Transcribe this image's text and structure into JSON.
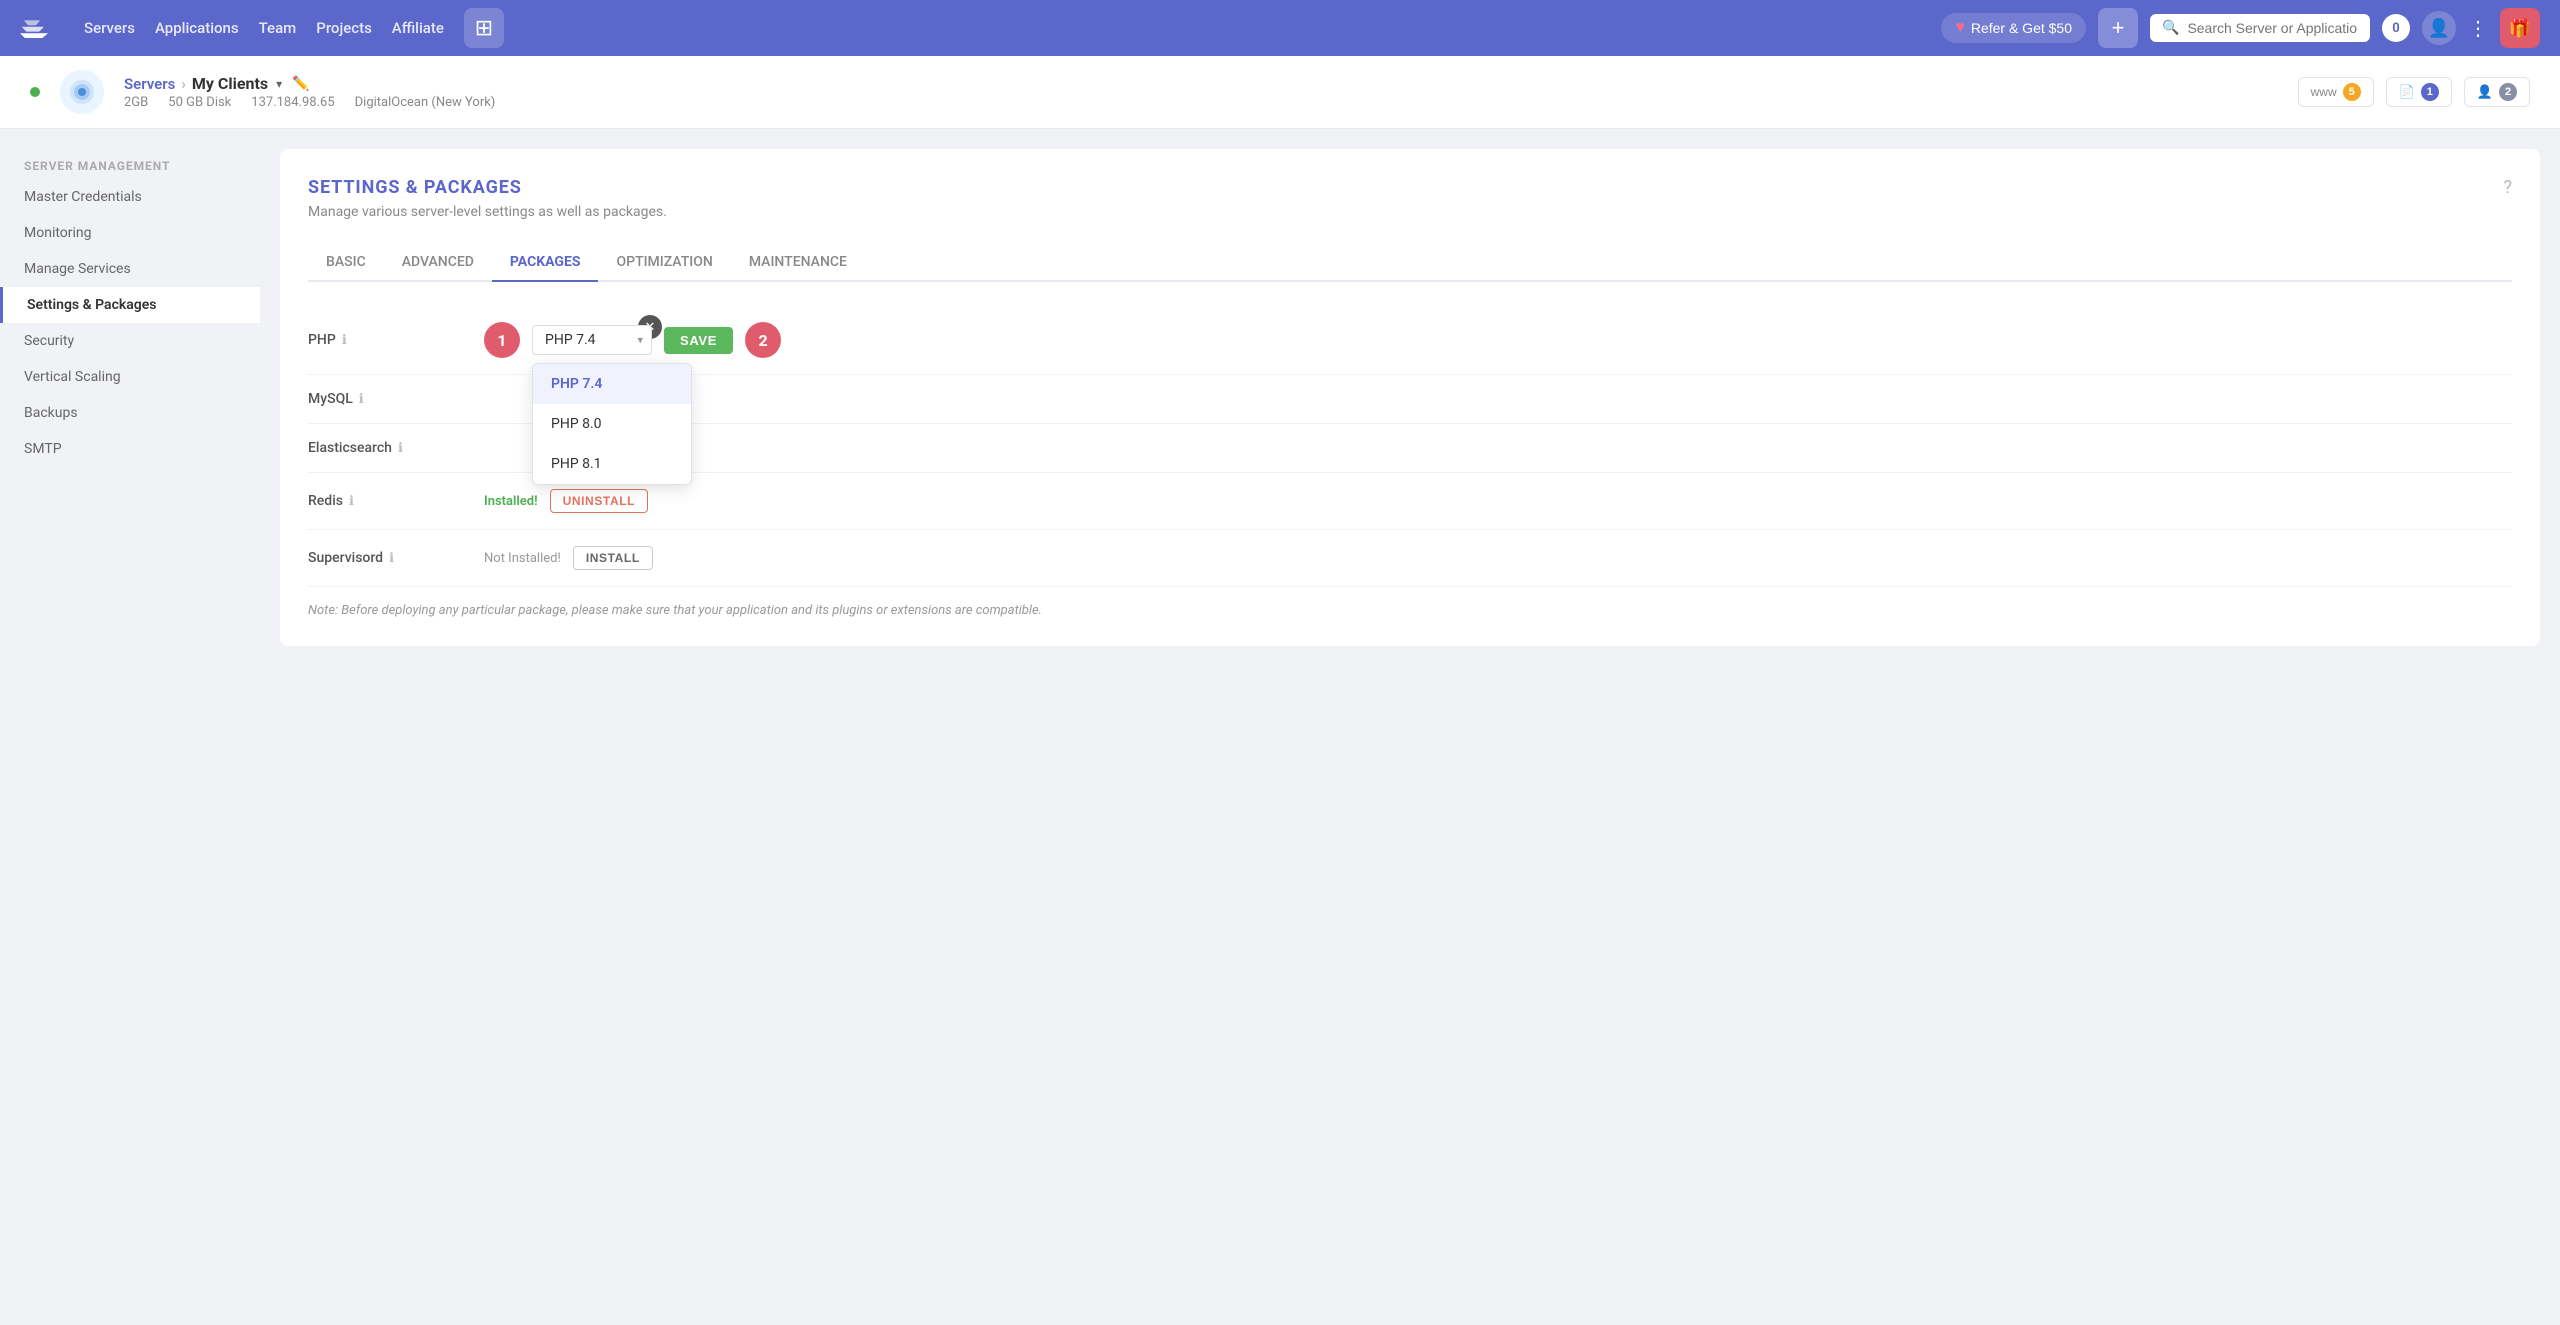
{
  "nav": {
    "links": [
      "Servers",
      "Applications",
      "Team",
      "Projects",
      "Affiliate"
    ],
    "refer_label": "Refer & Get $50",
    "search_placeholder": "Search Server or Application",
    "notification_count": "0"
  },
  "server": {
    "breadcrumb_link": "Servers",
    "name": "My Clients",
    "ram": "2GB",
    "disk": "50 GB Disk",
    "ip": "137.184.98.65",
    "provider": "DigitalOcean (New York)",
    "stats": {
      "www_count": "5",
      "file_count": "1",
      "user_count": "2"
    }
  },
  "sidebar": {
    "section_title": "Server Management",
    "items": [
      {
        "id": "master-credentials",
        "label": "Master Credentials"
      },
      {
        "id": "monitoring",
        "label": "Monitoring"
      },
      {
        "id": "manage-services",
        "label": "Manage Services"
      },
      {
        "id": "settings-packages",
        "label": "Settings & Packages",
        "active": true
      },
      {
        "id": "security",
        "label": "Security"
      },
      {
        "id": "vertical-scaling",
        "label": "Vertical Scaling"
      },
      {
        "id": "backups",
        "label": "Backups"
      },
      {
        "id": "smtp",
        "label": "SMTP"
      }
    ]
  },
  "content": {
    "title": "SETTINGS & PACKAGES",
    "subtitle": "Manage various server-level settings as well as packages.",
    "tabs": [
      "BASIC",
      "ADVANCED",
      "PACKAGES",
      "OPTIMIZATION",
      "MAINTENANCE"
    ],
    "active_tab": "PACKAGES",
    "packages": {
      "php": {
        "label": "PHP",
        "current_value": "PHP 7.4",
        "options": [
          "PHP 7.4",
          "PHP 8.0",
          "PHP 8.1"
        ],
        "save_label": "SAVE",
        "step1": "1",
        "step2": "2"
      },
      "mysql": {
        "label": "MySQL"
      },
      "elasticsearch": {
        "label": "Elasticsearch"
      },
      "redis": {
        "label": "Redis",
        "status": "Installed!",
        "action_label": "UNINSTALL"
      },
      "supervisord": {
        "label": "Supervisord",
        "status": "Not Installed!",
        "action_label": "INSTALL"
      }
    },
    "note": "Note: Before deploying any particular package, please make sure that your application and its plugins or extensions are compatible."
  }
}
